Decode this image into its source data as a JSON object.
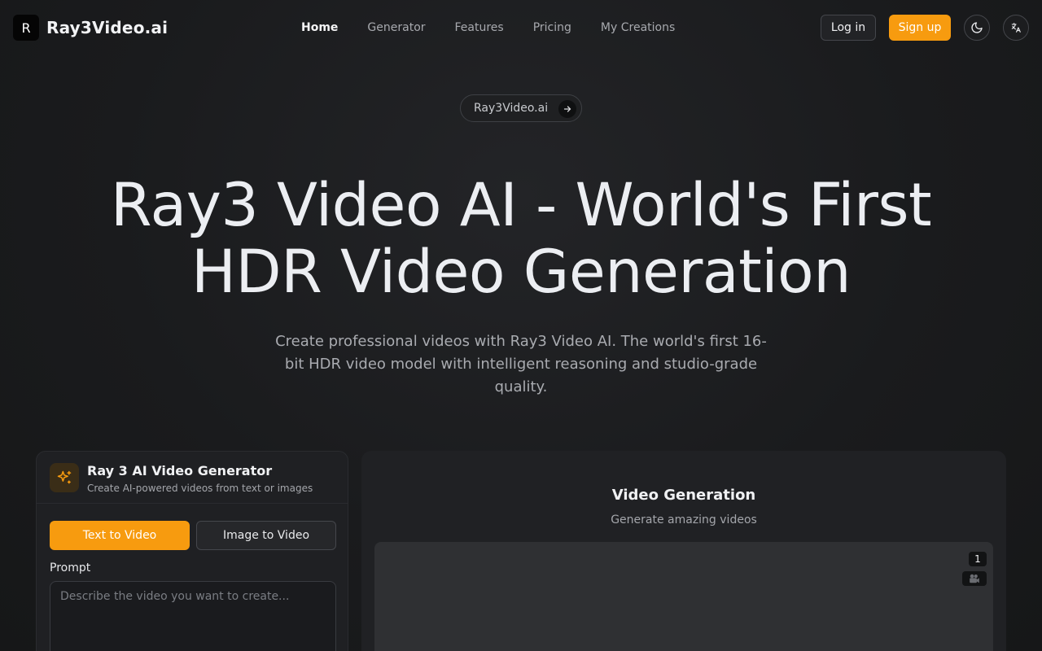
{
  "brand": {
    "logo_letter": "R",
    "name": "Ray3Video.ai"
  },
  "nav": {
    "items": [
      {
        "label": "Home",
        "active": true
      },
      {
        "label": "Generator",
        "active": false
      },
      {
        "label": "Features",
        "active": false
      },
      {
        "label": "Pricing",
        "active": false
      },
      {
        "label": "My Creations",
        "active": false
      }
    ]
  },
  "header_actions": {
    "login_label": "Log in",
    "signup_label": "Sign up",
    "theme_icon": "moon-icon",
    "language_icon": "translate-icon"
  },
  "hero": {
    "badge_label": "Ray3Video.ai",
    "title": "Ray3 Video AI - World's First HDR Video Generation",
    "subtitle": "Create professional videos with Ray3 Video AI. The world's first 16-bit HDR video model with intelligent reasoning and studio-grade quality."
  },
  "generator": {
    "title": "Ray 3 AI Video Generator",
    "description": "Create AI-powered videos from text or images",
    "tabs": [
      {
        "label": "Text to Video",
        "active": true
      },
      {
        "label": "Image to Video",
        "active": false
      }
    ],
    "prompt_label": "Prompt",
    "prompt_placeholder": "Describe the video you want to create..."
  },
  "output": {
    "title": "Video Generation",
    "subtitle": "Generate amazing videos",
    "count": "1"
  },
  "colors": {
    "accent": "#f79b0f",
    "background": "#1a1b1d",
    "panel": "#1f2023"
  }
}
